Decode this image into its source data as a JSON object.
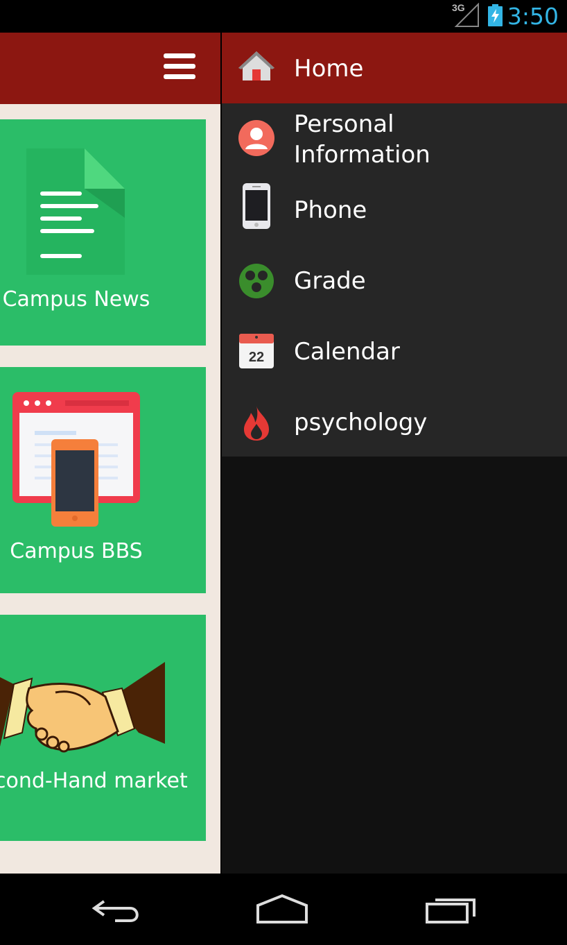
{
  "status_bar": {
    "network": "3G",
    "time": "3:50",
    "signal_icon": "signal-icon",
    "battery_icon": "battery-charging-icon",
    "time_color": "#33b5e5"
  },
  "header": {
    "menu_icon": "hamburger-menu-icon",
    "color": "#8c1711"
  },
  "tiles": [
    {
      "label": "Campus News",
      "icon": "document-icon"
    },
    {
      "label": "Campus BBS",
      "icon": "browser-phone-icon"
    },
    {
      "label": "cond-Hand market",
      "icon": "handshake-icon"
    }
  ],
  "tile_color": "#2bbd68",
  "drawer": {
    "items": [
      {
        "label": "Home",
        "icon": "home-icon",
        "active": true
      },
      {
        "label_line1": "Personal",
        "label_line2": "Information",
        "icon": "person-icon"
      },
      {
        "label": "Phone",
        "icon": "phone-icon"
      },
      {
        "label": "Grade",
        "icon": "grade-icon"
      },
      {
        "label": "Calendar",
        "icon": "calendar-icon",
        "calendar_day": "22"
      },
      {
        "label": "psychology",
        "icon": "flame-icon"
      }
    ]
  },
  "nav_bar": {
    "back_icon": "back-icon",
    "home_icon": "home-nav-icon",
    "recents_icon": "recents-icon"
  }
}
